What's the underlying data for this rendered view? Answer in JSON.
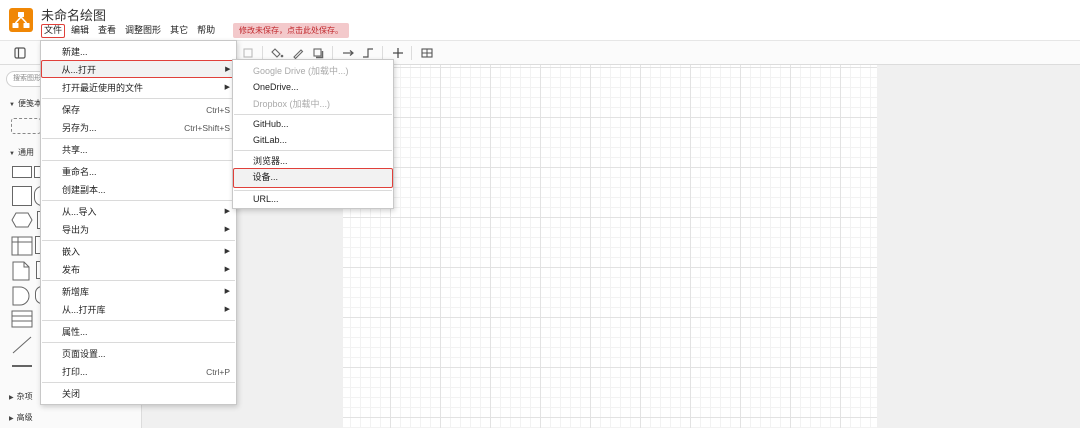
{
  "app": {
    "title": "未命名绘图",
    "unsaved_notice": "修改未保存，点击此处保存。"
  },
  "menubar": {
    "items": [
      "文件",
      "编辑",
      "查看",
      "调整图形",
      "其它",
      "帮助"
    ]
  },
  "sidebar": {
    "search_placeholder": "搜索图形",
    "sections": [
      "便笺本",
      "通用",
      "杂项",
      "高级"
    ]
  },
  "file_menu": {
    "items": [
      {
        "label": "新建..."
      },
      {
        "label": "从...打开",
        "submenu": true
      },
      {
        "label": "打开最近使用的文件",
        "submenu": true
      },
      {
        "label": "保存",
        "shortcut": "Ctrl+S"
      },
      {
        "label": "另存为...",
        "shortcut": "Ctrl+Shift+S"
      },
      {
        "label": "共享..."
      },
      {
        "label": "重命名..."
      },
      {
        "label": "创建副本..."
      },
      {
        "label": "从...导入",
        "submenu": true
      },
      {
        "label": "导出为",
        "submenu": true
      },
      {
        "label": "嵌入",
        "submenu": true
      },
      {
        "label": "发布",
        "submenu": true
      },
      {
        "label": "新增库",
        "submenu": true
      },
      {
        "label": "从...打开库",
        "submenu": true
      },
      {
        "label": "属性..."
      },
      {
        "label": "页面设置..."
      },
      {
        "label": "打印...",
        "shortcut": "Ctrl+P"
      },
      {
        "label": "关闭"
      }
    ]
  },
  "open_from_menu": {
    "items": [
      {
        "label": "Google Drive (加载中...)",
        "disabled": true
      },
      {
        "label": "OneDrive..."
      },
      {
        "label": "Dropbox (加载中...)",
        "disabled": true
      },
      {
        "label": "GitHub..."
      },
      {
        "label": "GitLab..."
      },
      {
        "label": "浏览器..."
      },
      {
        "label": "设备..."
      },
      {
        "label": "URL..."
      }
    ]
  },
  "colors": {
    "logo": "#f08705",
    "highlight_border": "#e0403a",
    "unsaved_bg": "#f3c9cb",
    "unsaved_text": "#c0282d"
  }
}
